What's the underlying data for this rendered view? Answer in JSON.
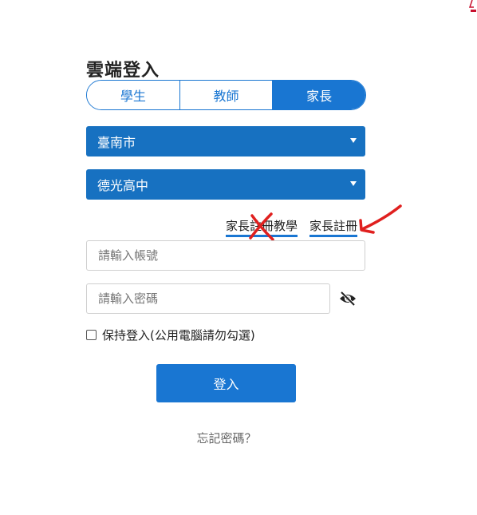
{
  "login": {
    "title": "雲端登入",
    "roles": [
      {
        "label": "學生",
        "active": false
      },
      {
        "label": "教師",
        "active": false
      },
      {
        "label": "家長",
        "active": true
      }
    ],
    "city_select": {
      "value": "臺南市"
    },
    "school_select": {
      "value": "德光高中"
    },
    "links": {
      "tutorial": "家長註冊教學",
      "register": "家長註冊"
    },
    "account_input": {
      "placeholder": "請輸入帳號"
    },
    "password_input": {
      "placeholder": "請輸入密碼"
    },
    "remember_label": "保持登入(公用電腦請勿勾選)",
    "login_button": "登入",
    "forgot_password": "忘記密碼？"
  },
  "annotations": {
    "cross_mark_icon": "red-x-icon",
    "arrow_icon": "red-arrow-icon"
  },
  "colors": {
    "primary": "#1976d2",
    "select_bg": "#1771c1",
    "annotation_red": "#e0201f"
  }
}
